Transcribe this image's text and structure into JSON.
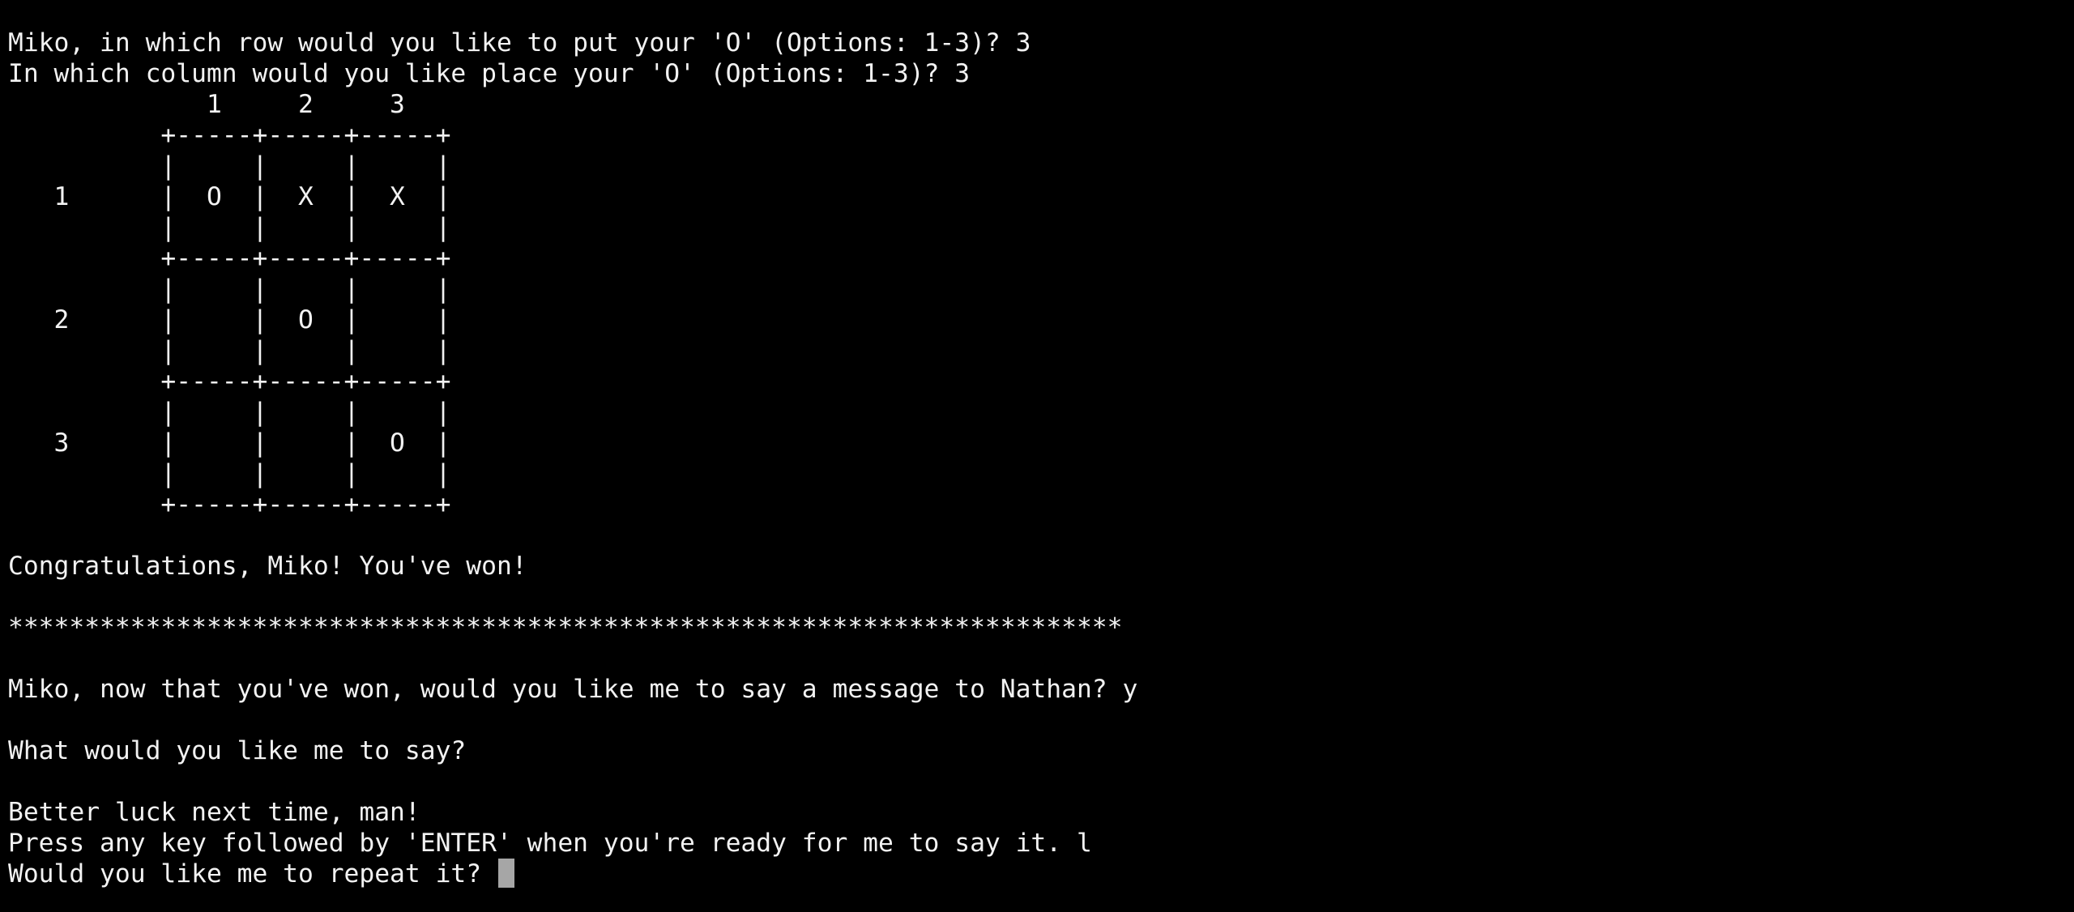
{
  "terminal": {
    "lines_top": [
      "Miko, in which row would you like to put your 'O' (Options: 1-3)? 3",
      "In which column would you like place your 'O' (Options: 1-3)? 3"
    ],
    "board": {
      "col_header": "             1     2     3",
      "border": "          +-----+-----+-----+",
      "spacer_rows": [
        "          |     |     |     |",
        "          |     |     |     |"
      ],
      "rows": [
        {
          "label": "   1",
          "text": "          |  O  |  X  |  X  |"
        },
        {
          "label": "   2",
          "text": "          |     |  O  |     |"
        },
        {
          "label": "   3",
          "text": "          |     |     |  O  |"
        }
      ]
    },
    "congrats": "Congratulations, Miko! You've won!",
    "stars": "*************************************************************************",
    "message_prompt": "Miko, now that you've won, would you like me to say a message to Nathan? y",
    "say_prompt": "What would you like me to say?",
    "message_text": "Better luck next time, man!",
    "enter_prompt": "Press any key followed by 'ENTER' when you're ready for me to say it. l",
    "repeat_prompt": "Would you like me to repeat it? "
  }
}
